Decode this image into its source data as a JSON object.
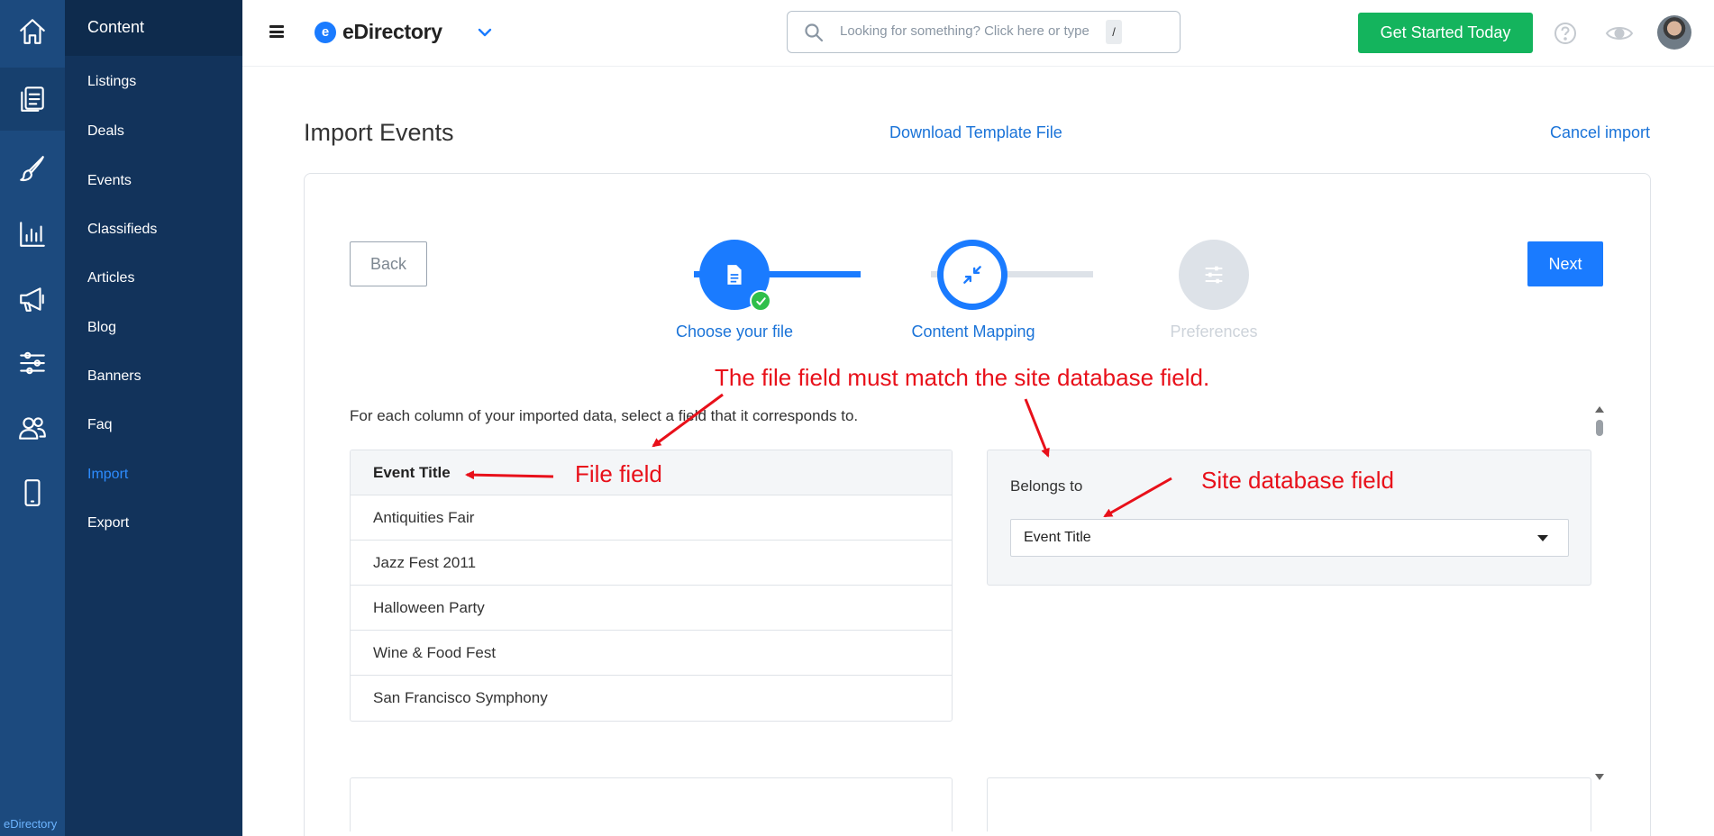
{
  "colors": {
    "accent": "#1a7bff",
    "success": "#14b45d",
    "rail": "#1c4a7e",
    "menu": "#12335b",
    "annotation": "#e8101a"
  },
  "rail": {
    "icons": [
      "home-icon",
      "content-icon",
      "design-icon",
      "reports-icon",
      "promote-icon",
      "settings-icon",
      "users-icon",
      "mobile-icon"
    ],
    "footer": "eDirectory"
  },
  "menu": {
    "header": "Content",
    "items": [
      {
        "label": "Listings"
      },
      {
        "label": "Deals"
      },
      {
        "label": "Events"
      },
      {
        "label": "Classifieds"
      },
      {
        "label": "Articles"
      },
      {
        "label": "Blog"
      },
      {
        "label": "Banners"
      },
      {
        "label": "Faq"
      },
      {
        "label": "Import"
      },
      {
        "label": "Export"
      }
    ],
    "active": "Import"
  },
  "topbar": {
    "logo_letter": "e",
    "logo_text": "eDirectory",
    "search_placeholder": "Looking for something? Click here or type",
    "search_key": "/",
    "cta_label": "Get Started Today"
  },
  "page": {
    "title": "Import Events",
    "download_link": "Download Template File",
    "cancel_link": "Cancel import"
  },
  "wizard": {
    "back_label": "Back",
    "next_label": "Next",
    "steps": [
      {
        "label": "Choose your file",
        "state": "done"
      },
      {
        "label": "Content Mapping",
        "state": "active"
      },
      {
        "label": "Preferences",
        "state": "pending"
      }
    ],
    "instructions": "For each column of your imported data, select a field that it corresponds to."
  },
  "mapping": {
    "file_header": "Event Title",
    "file_values": [
      "Antiquities Fair",
      "Jazz Fest 2011",
      "Halloween Party",
      "Wine & Food Fest",
      "San Francisco Symphony"
    ],
    "belongs_label": "Belongs to",
    "selected_field": "Event Title"
  },
  "annotations": {
    "main": "The file field must match the site database field.",
    "file_field": "File field",
    "db_field": "Site database field"
  }
}
